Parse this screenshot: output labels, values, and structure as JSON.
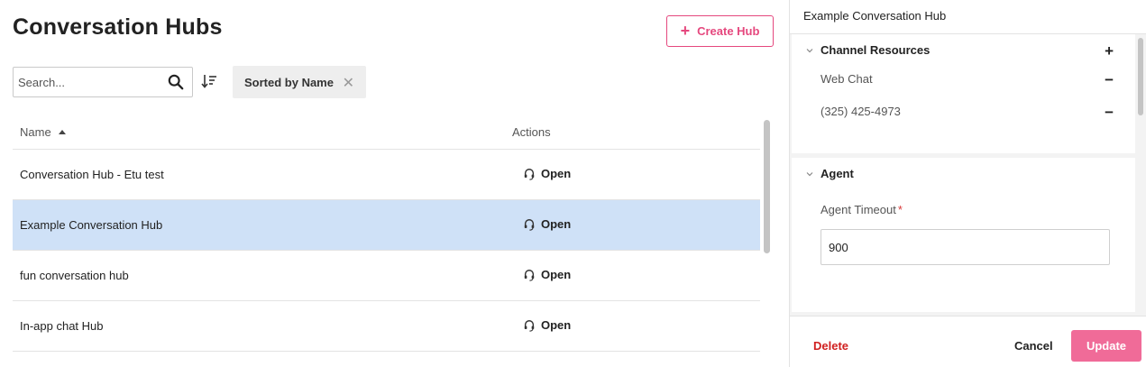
{
  "page": {
    "title": "Conversation Hubs"
  },
  "toolbar": {
    "create_label": "Create Hub",
    "search_placeholder": "Search...",
    "sort_chip_label": "Sorted by Name"
  },
  "table": {
    "columns": {
      "name": "Name",
      "actions": "Actions"
    },
    "rows": [
      {
        "name": "Conversation Hub - Etu test",
        "action": "Open"
      },
      {
        "name": "Example Conversation Hub",
        "action": "Open"
      },
      {
        "name": "fun conversation hub",
        "action": "Open"
      },
      {
        "name": "In-app chat Hub",
        "action": "Open"
      }
    ]
  },
  "detail": {
    "title": "Example Conversation Hub",
    "channel_resources": {
      "title": "Channel Resources",
      "items": [
        "Web Chat",
        "(325) 425-4973"
      ]
    },
    "agent": {
      "title": "Agent",
      "timeout_label": "Agent Timeout",
      "required_mark": "*",
      "timeout_value": "900"
    },
    "footer": {
      "delete_label": "Delete",
      "cancel_label": "Cancel",
      "update_label": "Update"
    }
  },
  "colors": {
    "accent": "#e5487e",
    "update_button": "#f06b98",
    "selected_row": "#cfe1f7",
    "delete_text": "#d01f1f"
  }
}
